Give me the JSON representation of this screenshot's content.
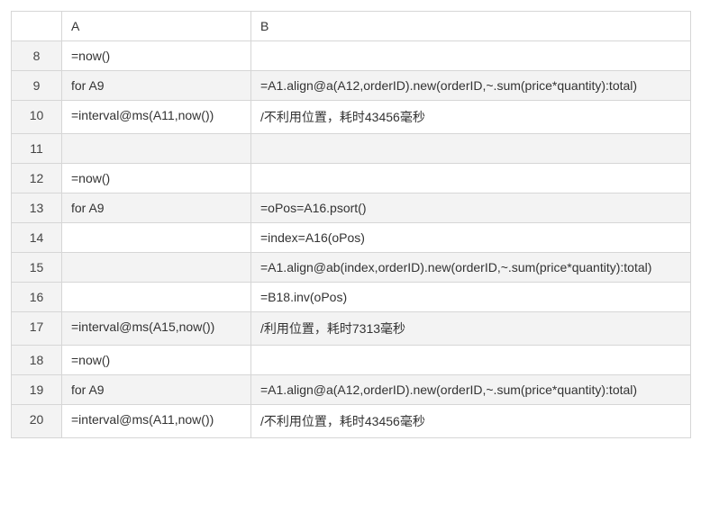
{
  "columns": {
    "A": "A",
    "B": "B"
  },
  "rows": [
    {
      "n": "8",
      "A": "=now()",
      "B": ""
    },
    {
      "n": "9",
      "A": "for A9",
      "B": "=A1.align@a(A12,orderID).new(orderID,~.sum(price*quantity):total)"
    },
    {
      "n": "10",
      "A": "=interval@ms(A11,now())",
      "B": "/不利用位置，耗时43456毫秒"
    },
    {
      "n": "11",
      "A": "",
      "B": ""
    },
    {
      "n": "12",
      "A": "=now()",
      "B": ""
    },
    {
      "n": "13",
      "A": "for A9",
      "B": "=oPos=A16.psort()"
    },
    {
      "n": "14",
      "A": "",
      "B": "=index=A16(oPos)"
    },
    {
      "n": "15",
      "A": "",
      "B": "=A1.align@ab(index,orderID).new(orderID,~.sum(price*quantity):total)"
    },
    {
      "n": "16",
      "A": "",
      "B": "=B18.inv(oPos)"
    },
    {
      "n": "17",
      "A": "=interval@ms(A15,now())",
      "B": "/利用位置，耗时7313毫秒"
    },
    {
      "n": "18",
      "A": "=now()",
      "B": ""
    },
    {
      "n": "19",
      "A": "for A9",
      "B": "=A1.align@a(A12,orderID).new(orderID,~.sum(price*quantity):total)"
    },
    {
      "n": "20",
      "A": "=interval@ms(A11,now())",
      "B": "/不利用位置，耗时43456毫秒"
    }
  ]
}
